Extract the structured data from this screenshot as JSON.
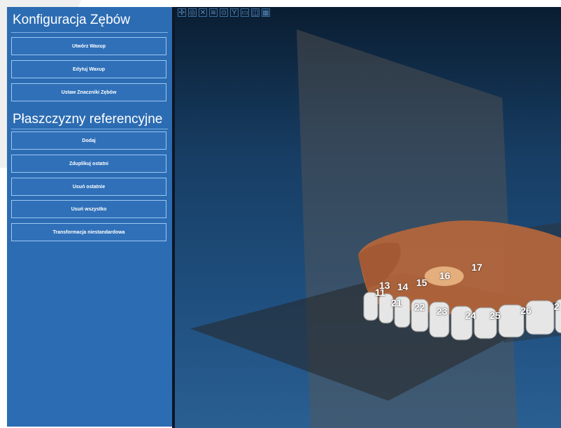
{
  "panel": {
    "title": "Konfiguracja Zębów",
    "section_title": "Płaszczyzny referencyjne",
    "buttons_top": [
      "Utwórz Waxup",
      "Edytuj Waxup",
      "Ustaw Znaczniki Zębów"
    ],
    "buttons_planes": [
      "Dodaj",
      "Zduplikuj ostatni",
      "Usuń ostatnie",
      "Usuń wszystko",
      "Transformacja niestandardowa"
    ]
  },
  "viewport": {
    "toolbar_icons": [
      "move-icon",
      "camera-icon",
      "cross-icon",
      "teeth-icon",
      "target-icon",
      "tooth-icon",
      "window-icon",
      "window-split-icon",
      "grid-icon"
    ],
    "tooth_labels": [
      "11",
      "13",
      "14",
      "15",
      "16",
      "17",
      "21",
      "22",
      "23",
      "24",
      "25",
      "26",
      "2"
    ]
  }
}
